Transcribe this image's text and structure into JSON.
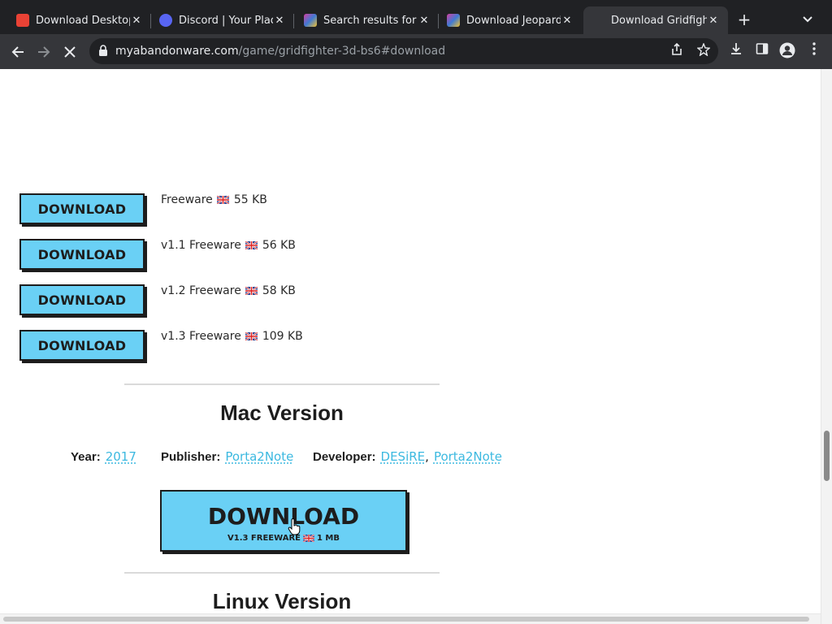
{
  "browser": {
    "tabs": [
      {
        "title": "Download Desktop",
        "favicon": "red-game-favicon",
        "color": "#e94235"
      },
      {
        "title": "Discord | Your Place",
        "favicon": "discord-favicon",
        "color": "#5865f2"
      },
      {
        "title": "Search results for t",
        "favicon": "colorful-site-favicon",
        "color": "#7a3fa8"
      },
      {
        "title": "Download Jeopardy",
        "favicon": "colorful-site-favicon",
        "color": "#7a3fa8"
      },
      {
        "title": "Download Gridfight",
        "favicon": "none",
        "color": "#35363a",
        "active": true
      }
    ],
    "close_glyph": "✕",
    "new_tab_glyph": "+",
    "url_host": "myabandonware.com",
    "url_path": "/game/gridfighter-3d-bs6#download"
  },
  "downloads": [
    {
      "button": "DOWNLOAD",
      "version": "",
      "license": "Freeware",
      "size": "55 KB"
    },
    {
      "button": "DOWNLOAD",
      "version": "v1.1",
      "license": "Freeware",
      "size": "56 KB"
    },
    {
      "button": "DOWNLOAD",
      "version": "v1.2",
      "license": "Freeware",
      "size": "58 KB"
    },
    {
      "button": "DOWNLOAD",
      "version": "v1.3",
      "license": "Freeware",
      "size": "109 KB"
    }
  ],
  "mac_section": {
    "title": "Mac Version",
    "year_label": "Year:",
    "year": "2017",
    "publisher_label": "Publisher:",
    "publisher": "Porta2Note",
    "developer_label": "Developer:",
    "developers": [
      "DESiRE",
      "Porta2Note"
    ],
    "separator": ",",
    "button_label": "DOWNLOAD",
    "button_sub_left": "V1.3 FREEWARE",
    "button_sub_right": "1 MB"
  },
  "linux_section": {
    "title": "Linux Version"
  },
  "colors": {
    "button_bg": "#6ad0f5",
    "link": "#3cb9e0",
    "chrome_dark": "#202124",
    "chrome_toolbar": "#35363a"
  }
}
